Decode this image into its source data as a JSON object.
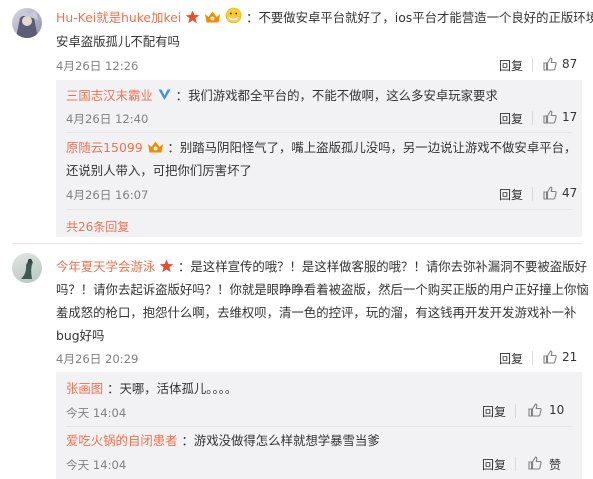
{
  "comments": [
    {
      "user": "Hu-Kei就是huke加kei",
      "text_lines": [
        "：不要做安卓平台就好了，ios平台才能营造一个良好的正版环境，",
        "安卓盗版孤儿不配有吗"
      ],
      "time": "4月26日 12:26",
      "reply_label": "回复",
      "likes": "87",
      "replies": [
        {
          "user": "三国志汉末霸业",
          "text": "：我们游戏都全平台的，不能不做啊，这么多安卓玩家要求",
          "time": "4月26日 12:40",
          "reply_label": "回复",
          "likes": "17"
        },
        {
          "user": "原随云15099",
          "text_lines": [
            "：别踏马阴阳怪气了，嘴上盗版孤儿没吗，另一边说让游戏不做安卓平台，",
            "还说别人带入，可把你们厉害坏了"
          ],
          "time": "4月26日 16:07",
          "reply_label": "回复",
          "likes": "47"
        }
      ],
      "more_replies": "共26条回复"
    },
    {
      "user": "今年夏天学会游泳",
      "text_lines": [
        "：是这样宣传的哦？！是这样做客服的哦？！请你去弥补漏洞不要被盗版好",
        "吗？！请你去起诉盗版好吗？！你就是眼睁睁看着被盗版，然后一个购买正版的用户正好撞上你恼",
        "羞成怒的枪口，抱怨什么啊，去维权呗，清一色的控评，玩的溜，有这钱再开发开发游戏补一补",
        "bug好吗"
      ],
      "time": "4月26日 20:29",
      "reply_label": "回复",
      "likes": "21",
      "replies": [
        {
          "user": "张画图",
          "text": "：天哪，活体孤儿。。。。",
          "time": "今天 14:04",
          "reply_label": "回复",
          "likes": "10"
        },
        {
          "user": "爱吃火锅的自闭患者",
          "text": "：游戏没做得怎么样就想学暴雪当爹",
          "time": "今天 14:04",
          "reply_label": "回复",
          "likes": "赞"
        }
      ]
    }
  ],
  "colors": {
    "username": "#eb7350",
    "text": "#333333",
    "meta": "#808080",
    "reply_bg": "#f2f2f5"
  },
  "icons": [
    "mask-face-emoji",
    "vip-crown-badge",
    "verified-v-badge",
    "thumbs-up-icon",
    "star-badge",
    "fan-badge"
  ]
}
